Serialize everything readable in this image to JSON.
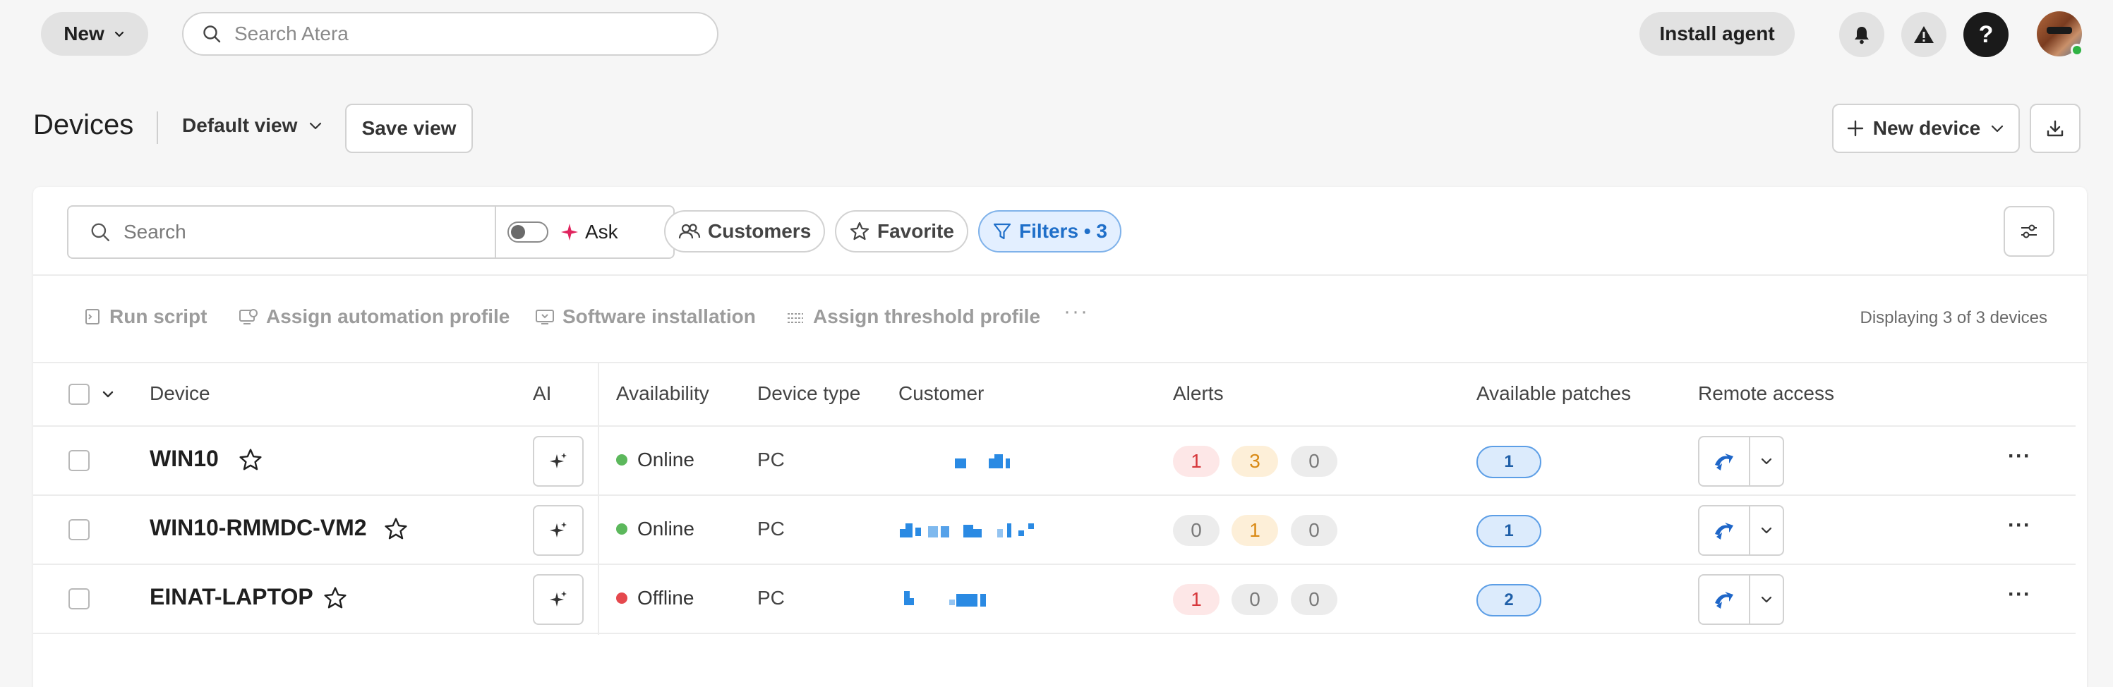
{
  "topbar": {
    "new_label": "New",
    "search_placeholder": "Search Atera",
    "install_agent_label": "Install agent",
    "help_glyph": "?",
    "icons": [
      "search-icon",
      "bell-icon",
      "warning-icon",
      "help-icon",
      "user-avatar"
    ]
  },
  "page": {
    "title": "Devices",
    "view_selector": "Default view",
    "save_view_label": "Save view",
    "new_device_label": "New device"
  },
  "filters": {
    "search_placeholder": "Search",
    "ask_label": "Ask",
    "customers_label": "Customers",
    "favorite_label": "Favorite",
    "filters_label": "Filters • 3"
  },
  "actions": {
    "run_script": "Run script",
    "assign_automation": "Assign automation profile",
    "software_installation": "Software installation",
    "assign_threshold": "Assign threshold profile",
    "more": "···",
    "display_count": "Displaying 3 of 3 devices"
  },
  "table": {
    "headers": {
      "device": "Device",
      "ai": "AI",
      "availability": "Availability",
      "device_type": "Device type",
      "customer": "Customer",
      "alerts": "Alerts",
      "patches": "Available patches",
      "remote": "Remote access"
    },
    "rows": [
      {
        "name": "WIN10",
        "availability": "Online",
        "device_type": "PC",
        "alerts": [
          "1",
          "3",
          "0"
        ],
        "patches": "1"
      },
      {
        "name": "WIN10-RMMDC-VM2",
        "availability": "Online",
        "device_type": "PC",
        "alerts": [
          "0",
          "1",
          "0"
        ],
        "patches": "1"
      },
      {
        "name": "EINAT-LAPTOP",
        "availability": "Offline",
        "device_type": "PC",
        "alerts": [
          "1",
          "0",
          "0"
        ],
        "patches": "2"
      }
    ],
    "row_more": "···"
  },
  "colors": {
    "online": "#5cb85c",
    "offline": "#e5484d",
    "accent_blue": "#1f6fc9",
    "alert_critical_bg": "#fde7e7",
    "alert_critical_fg": "#d6373b",
    "alert_warning_bg": "#fdefd8",
    "alert_warning_fg": "#d98a16",
    "alert_neutral_bg": "#ececec",
    "alert_neutral_fg": "#7a7a7a"
  }
}
